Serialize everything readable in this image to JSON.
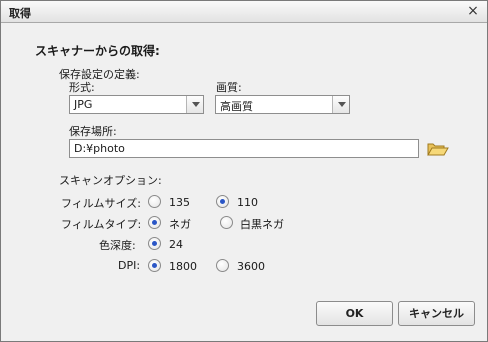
{
  "window": {
    "title": "取得",
    "close_glyph": "×"
  },
  "section_title": "スキャナーからの取得:",
  "save_settings": {
    "label": "保存設定の定義:",
    "format": {
      "label": "形式:",
      "selected": "JPG"
    },
    "quality": {
      "label": "画質:",
      "selected": "高画質"
    },
    "location": {
      "label": "保存場所:",
      "value": "D:¥photo",
      "icon": "folder-open-icon"
    }
  },
  "scan_options": {
    "label": "スキャンオプション:",
    "film_size": {
      "label": "フィルムサイズ:",
      "options": [
        "135",
        "110"
      ],
      "selected": "110"
    },
    "film_type": {
      "label": "フィルムタイプ:",
      "options": [
        "ネガ",
        "白黒ネガ"
      ],
      "selected": "ネガ"
    },
    "color_depth": {
      "label": "色深度:",
      "options": [
        "24"
      ],
      "selected": "24"
    },
    "dpi": {
      "label": "DPI:",
      "options": [
        "1800",
        "3600"
      ],
      "selected": "1800"
    }
  },
  "buttons": {
    "ok": "OK",
    "cancel": "キャンセル"
  },
  "colors": {
    "radio_selected": "#2a56c6",
    "dialog_bg": "#f0f0f0"
  }
}
